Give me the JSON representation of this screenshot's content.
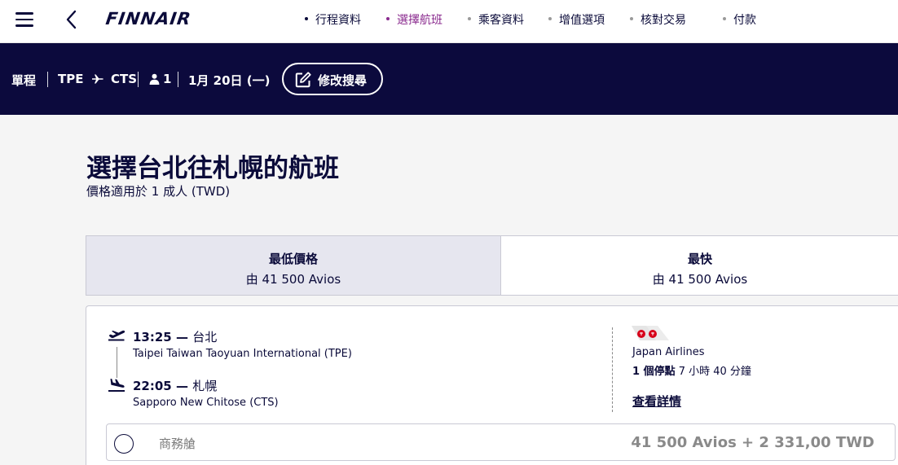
{
  "header": {
    "logo_text": "FINNAIR",
    "steps": [
      {
        "label": "行程資料",
        "state": "done"
      },
      {
        "label": "選擇航班",
        "state": "active"
      },
      {
        "label": "乘客資料",
        "state": "todo"
      },
      {
        "label": "增值選項",
        "state": "todo"
      },
      {
        "label": "核對交易",
        "state": "todo"
      },
      {
        "label": "付款",
        "state": "todo"
      }
    ]
  },
  "search_summary": {
    "trip_type": "單程",
    "origin": "TPE",
    "destination": "CTS",
    "passengers": "1",
    "date": "1月 20日 (一)",
    "edit_label": "修改搜尋"
  },
  "main": {
    "title": "選擇台北往札幌的航班",
    "subtitle": "價格適用於 1 成人 (TWD)",
    "tabs": [
      {
        "label": "最低價格",
        "price": "由 41 500 Avios",
        "selected": true
      },
      {
        "label": "最快",
        "price": "由 41 500 Avios",
        "selected": false
      }
    ],
    "flight": {
      "departure_time": "13:25 —",
      "departure_city": "台北",
      "departure_airport": "Taipei Taiwan Taoyuan International (TPE)",
      "arrival_time": "22:05 —",
      "arrival_city": "札幌",
      "arrival_airport": "Sapporo New Chitose (CTS)",
      "airline": "Japan Airlines",
      "stops": "1 個停點",
      "duration": "7 小時 40 分鐘",
      "details_label": "查看詳情",
      "fare": {
        "class": "商務艙",
        "price": "41 500 Avios + 2 331,00 TWD"
      }
    }
  },
  "colors": {
    "navy": "#0c0a3d",
    "active_step": "#8a2a8e",
    "tab_selected_bg": "#e6e6ef",
    "jal_red": "#d7001a"
  }
}
